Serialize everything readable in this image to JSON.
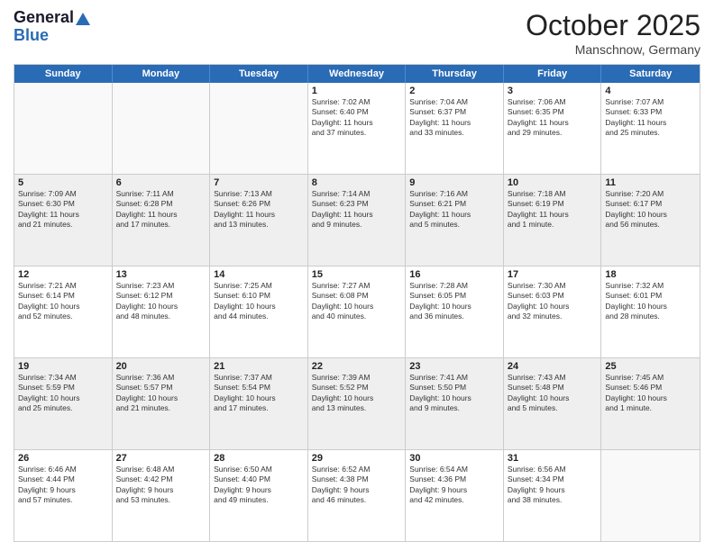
{
  "header": {
    "logo_line1": "General",
    "logo_line2": "Blue",
    "month": "October 2025",
    "location": "Manschnow, Germany"
  },
  "days_of_week": [
    "Sunday",
    "Monday",
    "Tuesday",
    "Wednesday",
    "Thursday",
    "Friday",
    "Saturday"
  ],
  "weeks": [
    [
      {
        "day": "",
        "lines": [],
        "empty": true
      },
      {
        "day": "",
        "lines": [],
        "empty": true
      },
      {
        "day": "",
        "lines": [],
        "empty": true
      },
      {
        "day": "1",
        "lines": [
          "Sunrise: 7:02 AM",
          "Sunset: 6:40 PM",
          "Daylight: 11 hours",
          "and 37 minutes."
        ]
      },
      {
        "day": "2",
        "lines": [
          "Sunrise: 7:04 AM",
          "Sunset: 6:37 PM",
          "Daylight: 11 hours",
          "and 33 minutes."
        ]
      },
      {
        "day": "3",
        "lines": [
          "Sunrise: 7:06 AM",
          "Sunset: 6:35 PM",
          "Daylight: 11 hours",
          "and 29 minutes."
        ]
      },
      {
        "day": "4",
        "lines": [
          "Sunrise: 7:07 AM",
          "Sunset: 6:33 PM",
          "Daylight: 11 hours",
          "and 25 minutes."
        ]
      }
    ],
    [
      {
        "day": "5",
        "lines": [
          "Sunrise: 7:09 AM",
          "Sunset: 6:30 PM",
          "Daylight: 11 hours",
          "and 21 minutes."
        ]
      },
      {
        "day": "6",
        "lines": [
          "Sunrise: 7:11 AM",
          "Sunset: 6:28 PM",
          "Daylight: 11 hours",
          "and 17 minutes."
        ]
      },
      {
        "day": "7",
        "lines": [
          "Sunrise: 7:13 AM",
          "Sunset: 6:26 PM",
          "Daylight: 11 hours",
          "and 13 minutes."
        ]
      },
      {
        "day": "8",
        "lines": [
          "Sunrise: 7:14 AM",
          "Sunset: 6:23 PM",
          "Daylight: 11 hours",
          "and 9 minutes."
        ]
      },
      {
        "day": "9",
        "lines": [
          "Sunrise: 7:16 AM",
          "Sunset: 6:21 PM",
          "Daylight: 11 hours",
          "and 5 minutes."
        ]
      },
      {
        "day": "10",
        "lines": [
          "Sunrise: 7:18 AM",
          "Sunset: 6:19 PM",
          "Daylight: 11 hours",
          "and 1 minute."
        ]
      },
      {
        "day": "11",
        "lines": [
          "Sunrise: 7:20 AM",
          "Sunset: 6:17 PM",
          "Daylight: 10 hours",
          "and 56 minutes."
        ]
      }
    ],
    [
      {
        "day": "12",
        "lines": [
          "Sunrise: 7:21 AM",
          "Sunset: 6:14 PM",
          "Daylight: 10 hours",
          "and 52 minutes."
        ]
      },
      {
        "day": "13",
        "lines": [
          "Sunrise: 7:23 AM",
          "Sunset: 6:12 PM",
          "Daylight: 10 hours",
          "and 48 minutes."
        ]
      },
      {
        "day": "14",
        "lines": [
          "Sunrise: 7:25 AM",
          "Sunset: 6:10 PM",
          "Daylight: 10 hours",
          "and 44 minutes."
        ]
      },
      {
        "day": "15",
        "lines": [
          "Sunrise: 7:27 AM",
          "Sunset: 6:08 PM",
          "Daylight: 10 hours",
          "and 40 minutes."
        ]
      },
      {
        "day": "16",
        "lines": [
          "Sunrise: 7:28 AM",
          "Sunset: 6:05 PM",
          "Daylight: 10 hours",
          "and 36 minutes."
        ]
      },
      {
        "day": "17",
        "lines": [
          "Sunrise: 7:30 AM",
          "Sunset: 6:03 PM",
          "Daylight: 10 hours",
          "and 32 minutes."
        ]
      },
      {
        "day": "18",
        "lines": [
          "Sunrise: 7:32 AM",
          "Sunset: 6:01 PM",
          "Daylight: 10 hours",
          "and 28 minutes."
        ]
      }
    ],
    [
      {
        "day": "19",
        "lines": [
          "Sunrise: 7:34 AM",
          "Sunset: 5:59 PM",
          "Daylight: 10 hours",
          "and 25 minutes."
        ]
      },
      {
        "day": "20",
        "lines": [
          "Sunrise: 7:36 AM",
          "Sunset: 5:57 PM",
          "Daylight: 10 hours",
          "and 21 minutes."
        ]
      },
      {
        "day": "21",
        "lines": [
          "Sunrise: 7:37 AM",
          "Sunset: 5:54 PM",
          "Daylight: 10 hours",
          "and 17 minutes."
        ]
      },
      {
        "day": "22",
        "lines": [
          "Sunrise: 7:39 AM",
          "Sunset: 5:52 PM",
          "Daylight: 10 hours",
          "and 13 minutes."
        ]
      },
      {
        "day": "23",
        "lines": [
          "Sunrise: 7:41 AM",
          "Sunset: 5:50 PM",
          "Daylight: 10 hours",
          "and 9 minutes."
        ]
      },
      {
        "day": "24",
        "lines": [
          "Sunrise: 7:43 AM",
          "Sunset: 5:48 PM",
          "Daylight: 10 hours",
          "and 5 minutes."
        ]
      },
      {
        "day": "25",
        "lines": [
          "Sunrise: 7:45 AM",
          "Sunset: 5:46 PM",
          "Daylight: 10 hours",
          "and 1 minute."
        ]
      }
    ],
    [
      {
        "day": "26",
        "lines": [
          "Sunrise: 6:46 AM",
          "Sunset: 4:44 PM",
          "Daylight: 9 hours",
          "and 57 minutes."
        ]
      },
      {
        "day": "27",
        "lines": [
          "Sunrise: 6:48 AM",
          "Sunset: 4:42 PM",
          "Daylight: 9 hours",
          "and 53 minutes."
        ]
      },
      {
        "day": "28",
        "lines": [
          "Sunrise: 6:50 AM",
          "Sunset: 4:40 PM",
          "Daylight: 9 hours",
          "and 49 minutes."
        ]
      },
      {
        "day": "29",
        "lines": [
          "Sunrise: 6:52 AM",
          "Sunset: 4:38 PM",
          "Daylight: 9 hours",
          "and 46 minutes."
        ]
      },
      {
        "day": "30",
        "lines": [
          "Sunrise: 6:54 AM",
          "Sunset: 4:36 PM",
          "Daylight: 9 hours",
          "and 42 minutes."
        ]
      },
      {
        "day": "31",
        "lines": [
          "Sunrise: 6:56 AM",
          "Sunset: 4:34 PM",
          "Daylight: 9 hours",
          "and 38 minutes."
        ]
      },
      {
        "day": "",
        "lines": [],
        "empty": true
      }
    ]
  ]
}
